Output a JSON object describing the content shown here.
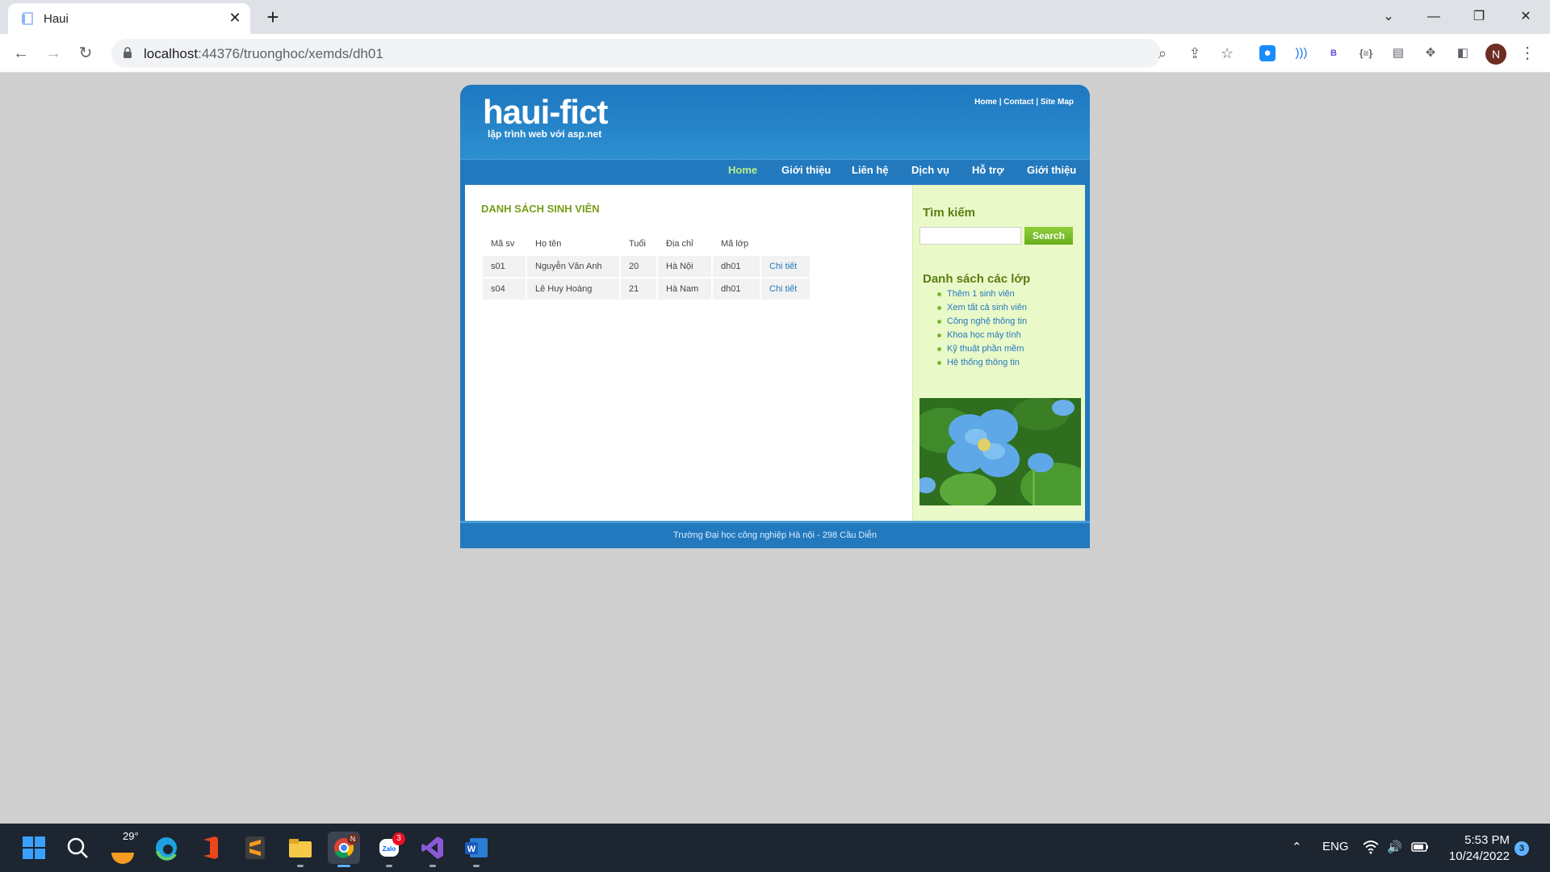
{
  "browser": {
    "tab_title": "Haui",
    "url_host": "localhost",
    "url_path": ":44376/truonghoc/xemds/dh01",
    "profile_initial": "N"
  },
  "site": {
    "logo": "haui-fict",
    "slogan": "lập trình web với asp.net",
    "top_links": [
      "Home",
      "Contact",
      "Site Map"
    ],
    "menu": [
      "Home",
      "Giới thiệu",
      "Liên hệ",
      "Dịch vụ",
      "Hỗ trợ",
      "Giới thiệu"
    ],
    "menu_active": "Home",
    "page_title": "DANH SÁCH SINH VIÊN",
    "table": {
      "headers": [
        "Mã sv",
        "Họ tên",
        "Tuổi",
        "Địa chỉ",
        "Mã lớp"
      ],
      "rows": [
        [
          "s01",
          "Nguyễn Văn Anh",
          "20",
          "Hà Nội",
          "dh01",
          "Chi tiết"
        ],
        [
          "s04",
          "Lê Huy Hoàng",
          "21",
          "Hà Nam",
          "dh01",
          "Chi tiết"
        ]
      ]
    },
    "sidebar": {
      "search_heading": "Tìm kiếm",
      "search_button": "Search",
      "search_value": "",
      "classes_heading": "Danh sách các lớp",
      "classes": [
        "Thêm 1 sinh viên",
        "Xem tất cả sinh viên",
        "Công nghệ thông tin",
        "Khoa học máy tính",
        "Kỹ thuật phần mềm",
        "Hệ thống thông tin"
      ]
    },
    "footer": "Trường Đại học công nghiệp Hà nội - 298 Cầu Diễn"
  },
  "taskbar": {
    "weather_temp": "29°",
    "zalo_badge": "3",
    "chrome_badge": "N",
    "language": "ENG",
    "time": "5:53 PM",
    "date": "10/24/2022",
    "notification_count": "3"
  },
  "colors": {
    "header_blue": "#1e78c0",
    "accent_green": "#7a9c1a",
    "sidebar_bg": "#eaf9c8",
    "link_blue": "#2379bd"
  }
}
